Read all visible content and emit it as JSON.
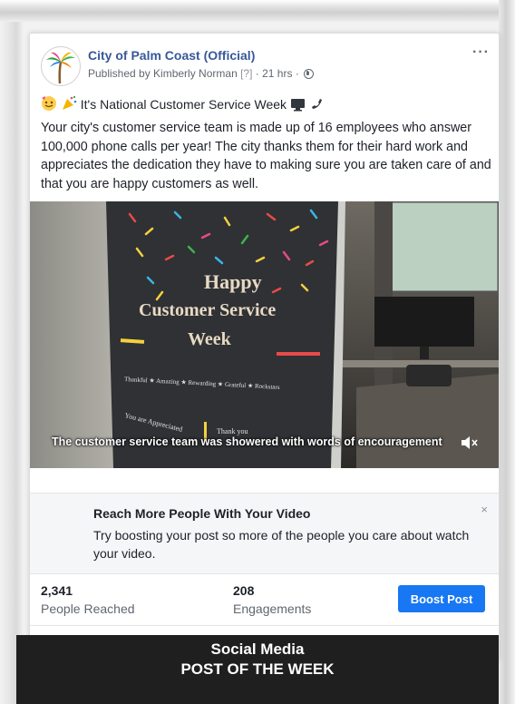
{
  "post": {
    "page_name": "City of Palm Coast (Official)",
    "published_by": "Published by Kimberly Norman",
    "help_marker": "[?]",
    "time": "21 hrs",
    "privacy_icon": "globe-icon",
    "more_icon": "more-options-icon",
    "headline": "It's National Customer Service Week",
    "body": "Your city's customer service team is made up of 16 employees who answer 100,000 phone calls per year! The city thanks them for their hard work and appreciates the dedication they have to making sure you are taken care of and that you are happy customers as well."
  },
  "video": {
    "poster_line1": "Happy",
    "poster_line2": "Customer Service",
    "poster_line3": "Week",
    "poster_words": "Thankful ★ Amazing ★ Rewarding ★ Grateful ★ Rockstars",
    "poster_bottom": "You are Appreciated",
    "poster_bottom2": "Thank you",
    "caption": "The customer service team was showered with words of encouragement",
    "mute_icon": "speaker-muted-icon"
  },
  "promo": {
    "title": "Reach More People With Your Video",
    "text": "Try boosting your post so more of the people you care about watch your video.",
    "close": "×"
  },
  "stats": {
    "reached_value": "2,341",
    "reached_label": "People Reached",
    "engagements_value": "208",
    "engagements_label": "Engagements",
    "boost_label": "Boost Post"
  },
  "banner": {
    "line1": "Social Media",
    "line2": "POST OF THE WEEK"
  },
  "colors": {
    "link": "#385898",
    "boost_button": "#1877f2",
    "banner": "#1f1f1f"
  }
}
